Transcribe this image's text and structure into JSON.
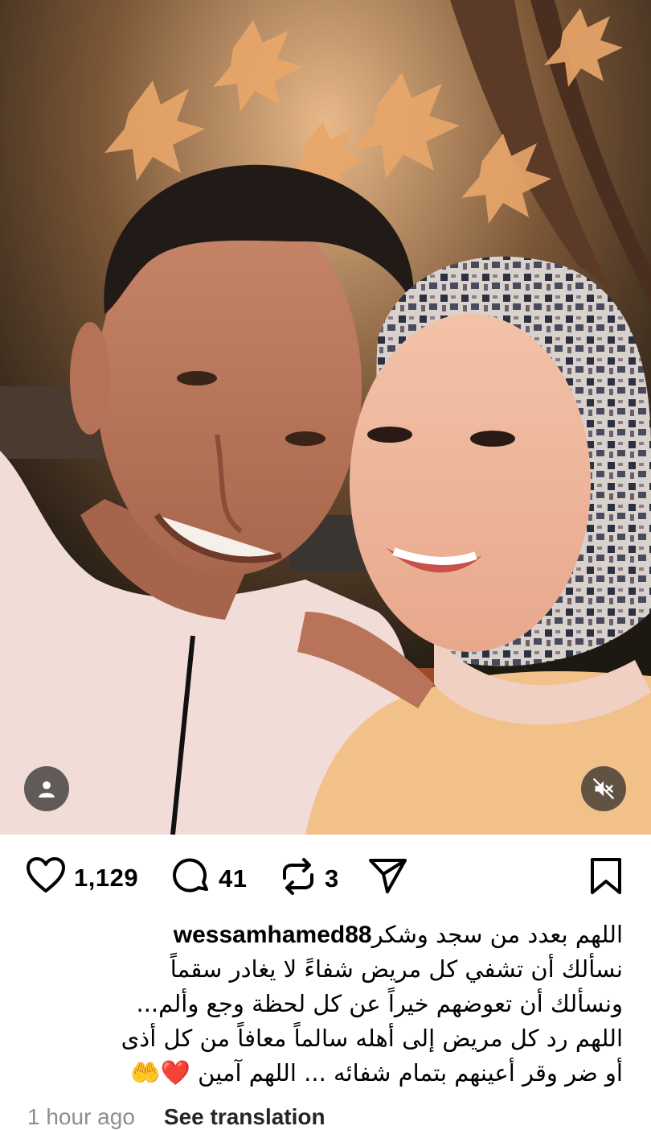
{
  "post": {
    "username": "wessamhamed88",
    "photo_alt": "",
    "caption_lines": [
      "اللهم بعدد من سجد وشكر",
      "نسألك أن تشفي كل مريض شفاءً لا يغادر سقماً",
      "ونسألك أن تعوضهم خيراً عن كل لحظة وجع وألم...",
      "اللهم رد كل مريض إلى أهله سالماً معافاً من كل أذى",
      "أو ضر وقر أعينهم بتمام شفائه ... اللهم آمين"
    ],
    "caption_emoji": "❤️🤲",
    "time_ago": "1 hour ago",
    "see_translation": "See translation"
  },
  "actions": {
    "likes": "1,129",
    "comments": "41",
    "reposts": "3"
  },
  "icons": {
    "user_tag": "person-icon",
    "mute": "speaker-muted-icon",
    "like": "heart-icon",
    "comment": "comment-bubble-icon",
    "repost": "repost-icon",
    "share": "paper-plane-icon",
    "save": "bookmark-icon"
  },
  "colors": {
    "text": "#000000",
    "muted": "#8e8e8e",
    "overlay": "#282828"
  }
}
